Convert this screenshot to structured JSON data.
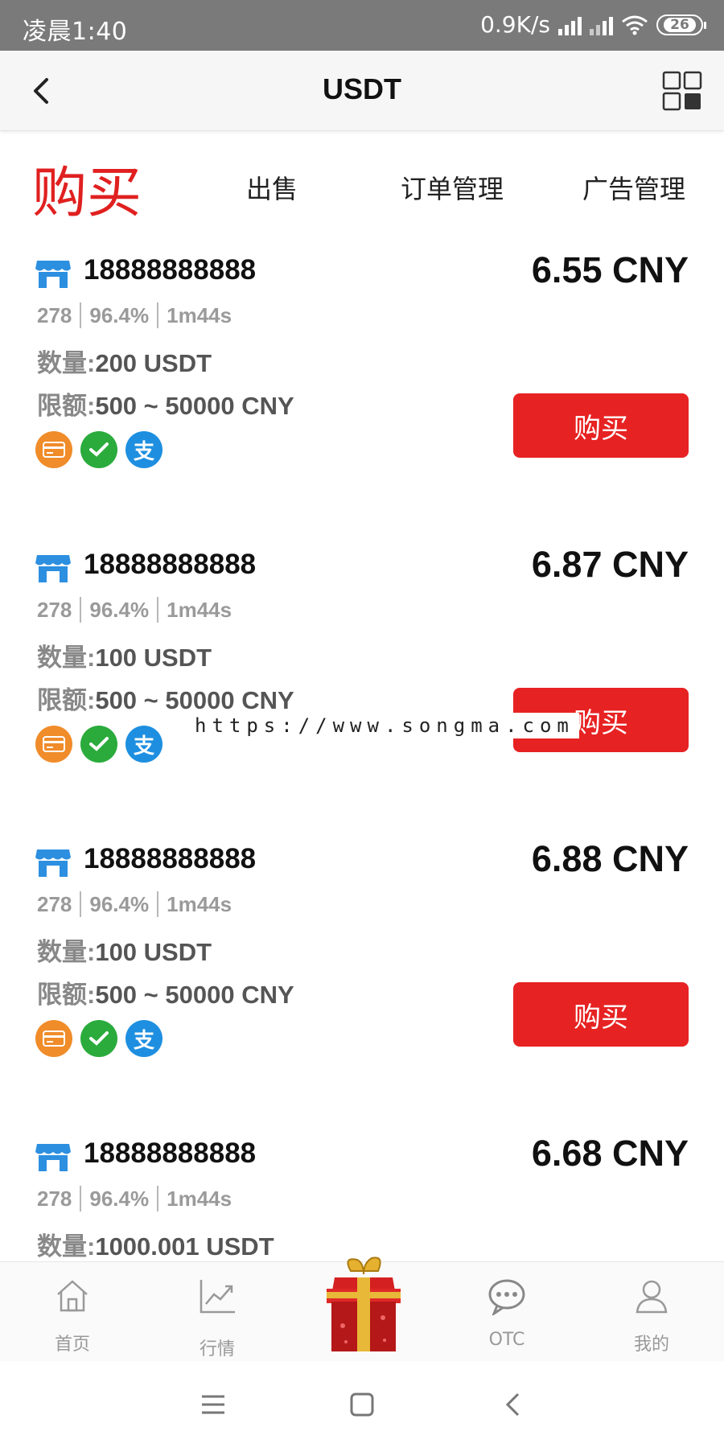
{
  "status_bar": {
    "time": "凌晨1:40",
    "speed": "0.9K/s",
    "battery": "26"
  },
  "header": {
    "title": "USDT"
  },
  "tabs": [
    {
      "label": "购买",
      "active": true
    },
    {
      "label": "出售",
      "active": false
    },
    {
      "label": "订单管理",
      "active": false
    },
    {
      "label": "广告管理",
      "active": false
    }
  ],
  "offers": [
    {
      "user": "18888888888",
      "price": "6.55 CNY",
      "trades": "278",
      "rate": "96.4%",
      "time": "1m44s",
      "qty_label": "数量:",
      "qty_value": "200 USDT",
      "limit_label": "限额:",
      "limit_value": "500 ~ 50000 CNY",
      "button": "购买"
    },
    {
      "user": "18888888888",
      "price": "6.87 CNY",
      "trades": "278",
      "rate": "96.4%",
      "time": "1m44s",
      "qty_label": "数量:",
      "qty_value": "100 USDT",
      "limit_label": "限额:",
      "limit_value": "500 ~ 50000 CNY",
      "button": "购买"
    },
    {
      "user": "18888888888",
      "price": "6.88 CNY",
      "trades": "278",
      "rate": "96.4%",
      "time": "1m44s",
      "qty_label": "数量:",
      "qty_value": "100 USDT",
      "limit_label": "限额:",
      "limit_value": "500 ~ 50000 CNY",
      "button": "购买"
    },
    {
      "user": "18888888888",
      "price": "6.68 CNY",
      "trades": "278",
      "rate": "96.4%",
      "time": "1m44s",
      "qty_label": "数量:",
      "qty_value": "1000.001 USDT"
    }
  ],
  "watermark": "https://www.songma.com",
  "bottom_nav": [
    {
      "label": "首页",
      "icon": "home-icon"
    },
    {
      "label": "行情",
      "icon": "chart-icon"
    },
    {
      "label": "OTC",
      "icon": "chat-bubble-icon"
    },
    {
      "label": "我的",
      "icon": "user-icon"
    }
  ],
  "colors": {
    "accent": "#e72222",
    "status_bar": "#7a7a7a"
  }
}
